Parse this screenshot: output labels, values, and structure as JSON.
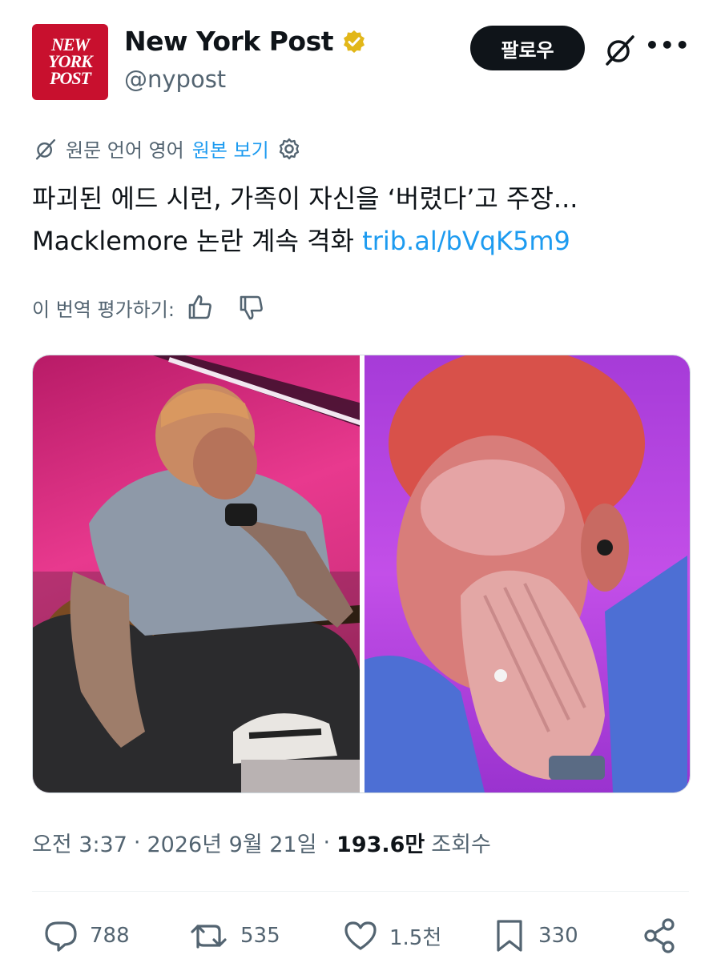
{
  "account": {
    "logo_lines": [
      "NEW",
      "YORK",
      "POST"
    ],
    "name": "New York Post",
    "handle": "@nypost",
    "follow_label": "팔로우",
    "more_label": "•••"
  },
  "translation": {
    "source_text": "원문 언어 영어",
    "show_original": "원본 보기"
  },
  "tweet": {
    "text": "파괴된 에드 시런, 가족이 자신을 ‘버렸다’고 주장... Macklemore 논란 계속 격화 ",
    "link": "trib.al/bVqK5m9"
  },
  "rate_label": "이 번역 평가하기:",
  "meta": {
    "time": "오전 3:37",
    "date": "2026년 9월 21일",
    "views": "193.6만",
    "views_label": "조회수"
  },
  "actions": {
    "replies": "788",
    "reposts": "535",
    "likes": "1.5천",
    "bookmarks": "330"
  },
  "colors": {
    "accent": "#1d9bf0",
    "brand": "#c8102e",
    "verified": "#e2b719"
  }
}
